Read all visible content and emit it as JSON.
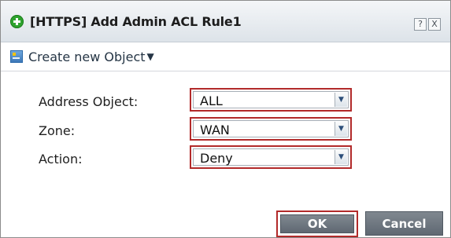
{
  "dialog": {
    "title": "[HTTPS] Add Admin ACL Rule1",
    "help_button": "?",
    "close_button": "X"
  },
  "toolbar": {
    "create_label": "Create new Object",
    "caret": "▼"
  },
  "form": {
    "address_object": {
      "label": "Address Object:",
      "value": "ALL"
    },
    "zone": {
      "label": "Zone:",
      "value": "WAN"
    },
    "action": {
      "label": "Action:",
      "value": "Deny"
    }
  },
  "buttons": {
    "ok": "OK",
    "cancel": "Cancel"
  },
  "colors": {
    "highlight": "#b22a2a",
    "button": "#6b747d",
    "title_icon": "#2fa32f"
  }
}
